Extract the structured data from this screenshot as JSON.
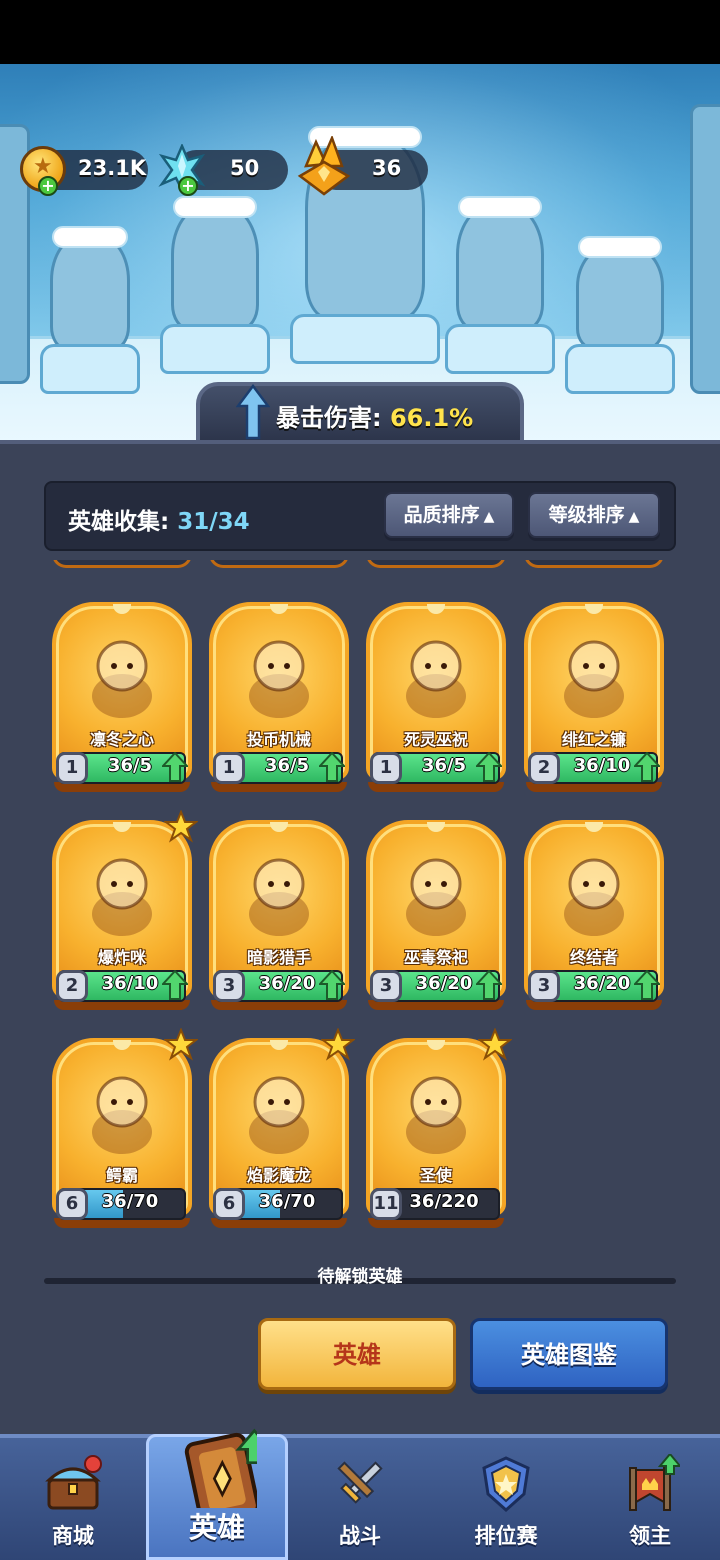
{
  "currency": {
    "coins": "23.1K",
    "crystals": "50",
    "gold_shards": "36"
  },
  "crit": {
    "label": "暴击伤害:",
    "value": "66.1%"
  },
  "collection": {
    "label": "英雄收集:",
    "count": "31/34",
    "sort_quality": "品质排序",
    "sort_level": "等级排序"
  },
  "heroes": [
    {
      "name": "凛冬之心",
      "level": "1",
      "progress": "36/5",
      "fill": 1.0,
      "bar": "green",
      "upgradable": true,
      "starred": false,
      "icon": "ice-queen-icon"
    },
    {
      "name": "投币机械",
      "level": "1",
      "progress": "36/5",
      "fill": 1.0,
      "bar": "green",
      "upgradable": true,
      "starred": false,
      "icon": "coin-robot-icon"
    },
    {
      "name": "死灵巫祝",
      "level": "1",
      "progress": "36/5",
      "fill": 1.0,
      "bar": "green",
      "upgradable": true,
      "starred": false,
      "icon": "necromancer-icon"
    },
    {
      "name": "绯红之镰",
      "level": "2",
      "progress": "36/10",
      "fill": 1.0,
      "bar": "green",
      "upgradable": true,
      "starred": false,
      "icon": "crimson-scythe-icon"
    },
    {
      "name": "爆炸咪",
      "level": "2",
      "progress": "36/10",
      "fill": 1.0,
      "bar": "green",
      "upgradable": true,
      "starred": true,
      "icon": "bomb-cat-icon"
    },
    {
      "name": "暗影猎手",
      "level": "3",
      "progress": "36/20",
      "fill": 1.0,
      "bar": "green",
      "upgradable": true,
      "starred": false,
      "icon": "shadow-hunter-icon"
    },
    {
      "name": "巫毒祭祀",
      "level": "3",
      "progress": "36/20",
      "fill": 1.0,
      "bar": "green",
      "upgradable": true,
      "starred": false,
      "icon": "voodoo-priestess-icon"
    },
    {
      "name": "终结者",
      "level": "3",
      "progress": "36/20",
      "fill": 1.0,
      "bar": "green",
      "upgradable": true,
      "starred": false,
      "icon": "terminator-icon"
    },
    {
      "name": "鳄霸",
      "level": "6",
      "progress": "36/70",
      "fill": 0.51,
      "bar": "blue",
      "upgradable": false,
      "starred": true,
      "icon": "croc-boss-icon"
    },
    {
      "name": "焰影魔龙",
      "level": "6",
      "progress": "36/70",
      "fill": 0.51,
      "bar": "blue",
      "upgradable": false,
      "starred": true,
      "icon": "shadow-dragon-icon"
    },
    {
      "name": "圣使",
      "level": "11",
      "progress": "36/220",
      "fill": 0.16,
      "bar": "blue",
      "upgradable": false,
      "starred": true,
      "icon": "angel-icon"
    }
  ],
  "locked_label": "待解锁英雄",
  "actions": {
    "hero": "英雄",
    "codex": "英雄图鉴"
  },
  "nav": {
    "shop": "商城",
    "heroes": "英雄",
    "battle": "战斗",
    "ranked": "排位赛",
    "lord": "领主"
  },
  "colors": {
    "panel": "#3b4358",
    "card_orange": "#f8b12e",
    "progress_green": "#2fb862",
    "progress_blue": "#3297c9",
    "crit_yellow": "#ffe34c",
    "nav_blue": "#2f4575"
  }
}
